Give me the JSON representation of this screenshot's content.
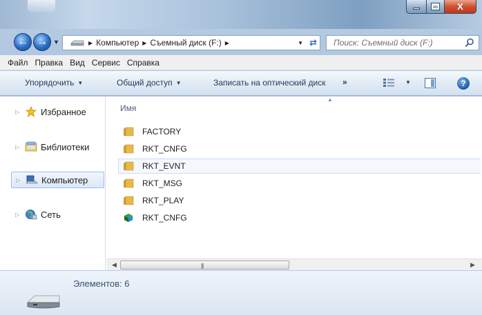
{
  "window": {
    "caption_buttons": {
      "minimize": "–",
      "maximize": "□",
      "close": "X"
    }
  },
  "address": {
    "segments": [
      "Компьютер",
      "Съемный диск (F:)"
    ]
  },
  "search": {
    "placeholder": "Поиск: Съемный диск (F:)"
  },
  "menu": [
    "Файл",
    "Правка",
    "Вид",
    "Сервис",
    "Справка"
  ],
  "toolbar": {
    "organize": "Упорядочить",
    "share": "Общий доступ",
    "burn": "Записать на оптический диск",
    "more": "»",
    "help": "?"
  },
  "nav": [
    {
      "label": "Избранное",
      "icon": "star-icon"
    },
    {
      "label": "Библиотеки",
      "icon": "libraries-icon"
    },
    {
      "label": "Компьютер",
      "icon": "computer-icon",
      "selected": true
    },
    {
      "label": "Сеть",
      "icon": "network-icon"
    }
  ],
  "files": {
    "column_name": "Имя",
    "items": [
      {
        "name": "FACTORY",
        "type": "folder"
      },
      {
        "name": "RKT_CNFG",
        "type": "folder"
      },
      {
        "name": "RKT_EVNT",
        "type": "folder"
      },
      {
        "name": "RKT_MSG",
        "type": "folder"
      },
      {
        "name": "RKT_PLAY",
        "type": "folder"
      },
      {
        "name": "RKT_CNFG",
        "type": "file"
      }
    ]
  },
  "details": {
    "count": "Элементов: 6"
  },
  "colors": {
    "folder": "#e8b94a",
    "selection_border": "#9cbde6",
    "accent_blue": "#2b6cc4"
  }
}
